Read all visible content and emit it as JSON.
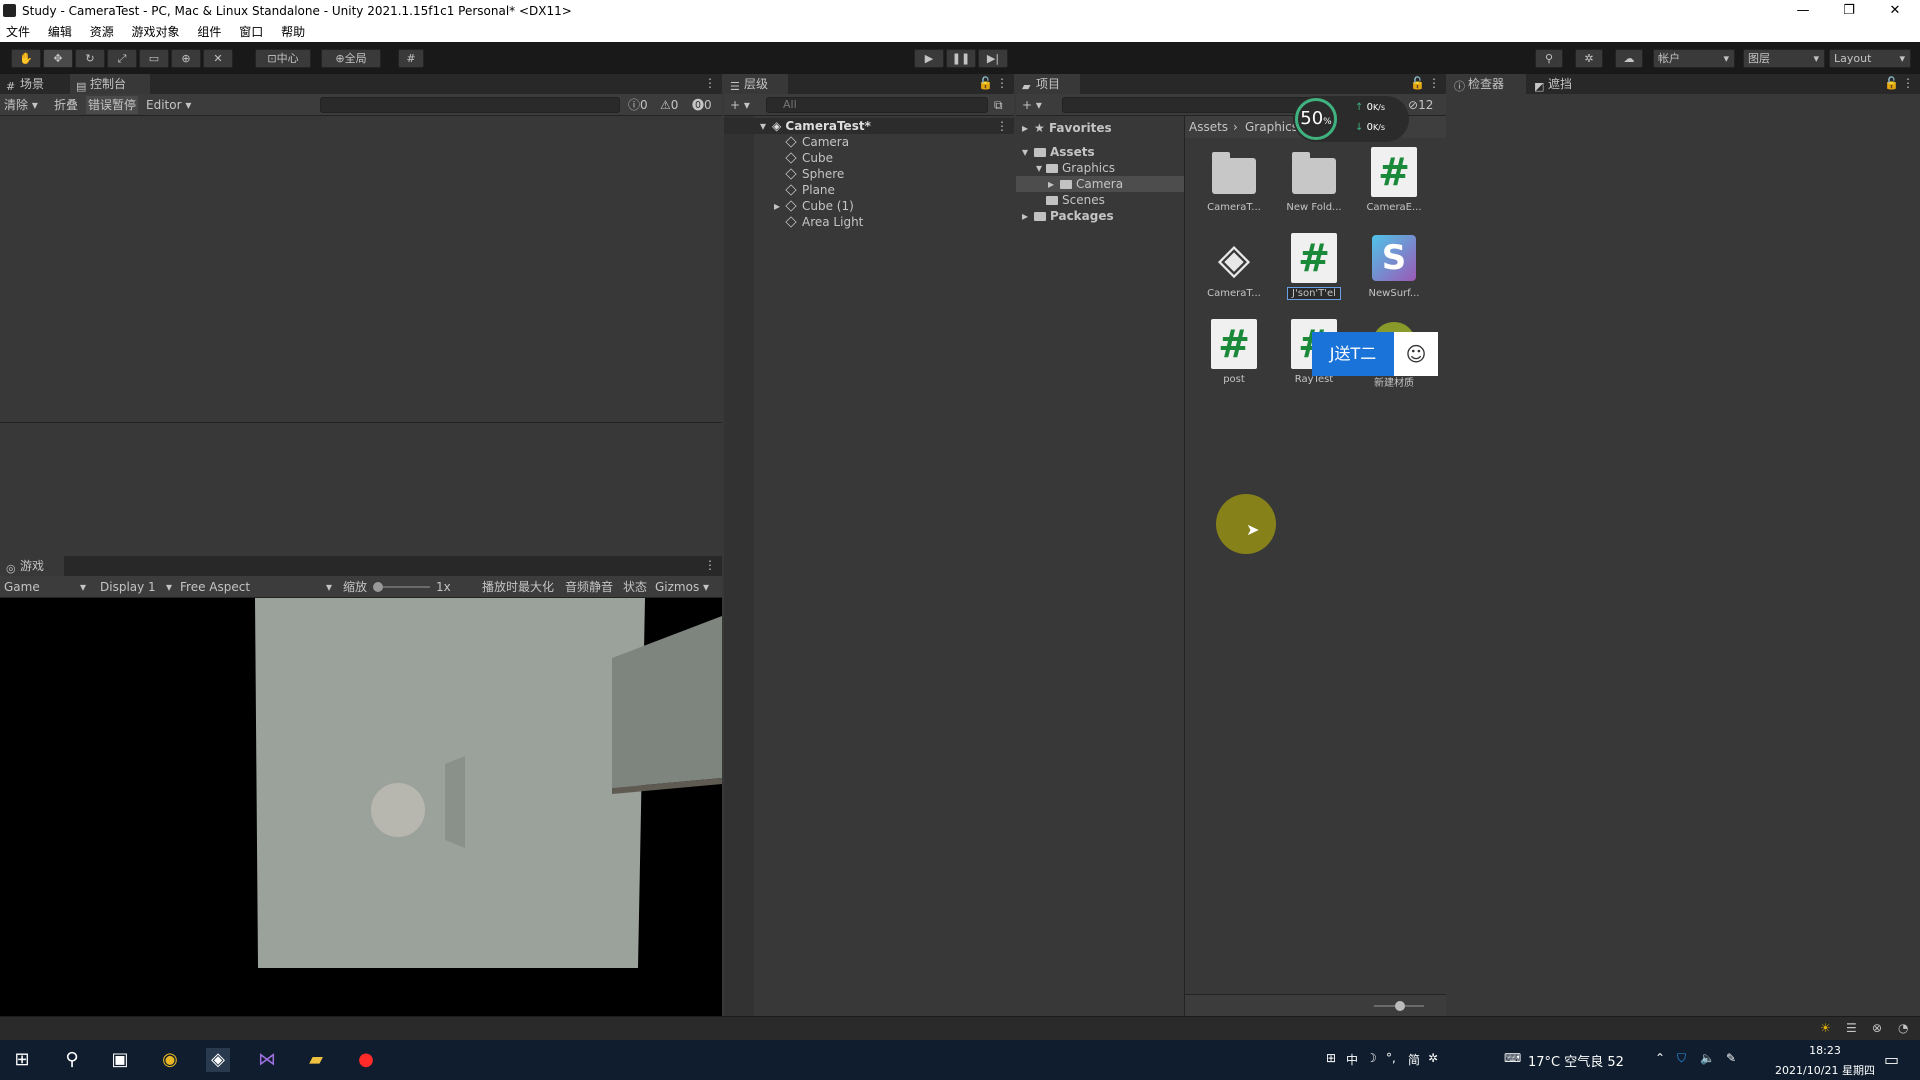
{
  "window": {
    "title": "Study - CameraTest - PC, Mac & Linux Standalone - Unity 2021.1.15f1c1 Personal* <DX11>",
    "controls": [
      "—",
      "❐",
      "✕"
    ]
  },
  "menu": [
    "文件",
    "编辑",
    "资源",
    "游戏对象",
    "组件",
    "窗口",
    "帮助"
  ],
  "toolbar": {
    "pivot_label": "中心",
    "global_label": "全局",
    "account_label": "帐户",
    "layers_label": "图层",
    "layout_label": "Layout"
  },
  "scene_panel": {
    "tabs": [
      "场景",
      "控制台"
    ],
    "console_bar": {
      "clear": "清除",
      "collapse": "折叠",
      "error_pause": "错误暂停",
      "editor": "Editor",
      "count_log": "0",
      "count_warn": "0",
      "count_error": "0"
    }
  },
  "game_panel": {
    "tab": "游戏",
    "game_select": "Game",
    "display": "Display 1",
    "aspect": "Free Aspect",
    "scale_label": "缩放",
    "scale_value": "1x",
    "maximize": "播放时最大化",
    "mute": "音频静音",
    "stats": "状态",
    "gizmos": "Gizmos"
  },
  "hierarchy": {
    "tab": "层级",
    "search_placeholder": "All",
    "root": "CameraTest*",
    "items": [
      "Camera",
      "Cube",
      "Sphere",
      "Plane",
      "Cube (1)",
      "Area Light"
    ]
  },
  "project": {
    "tab": "项目",
    "hidden_count": "12",
    "favorites": "Favorites",
    "assets": "Assets",
    "graphics": "Graphics",
    "camera": "Camera",
    "scenes": "Scenes",
    "packages": "Packages",
    "breadcrumb": [
      "Assets",
      "Graphics"
    ],
    "grid": [
      "CameraT...",
      "New Fold...",
      "CameraE...",
      "CameraT...",
      "J'son'T'el",
      "NewSurf...",
      "post",
      "RayTest",
      "新建材质"
    ]
  },
  "inspector": {
    "tabs": [
      "检查器",
      "遮挡"
    ]
  },
  "overlays": {
    "net_percent": "50",
    "net_up": "0",
    "net_down": "0",
    "ime_text": "J送T二"
  },
  "taskbar": {
    "ime": [
      "中",
      "简"
    ],
    "weather": "17°C 空气良 52",
    "time": "18:23",
    "date": "2021/10/21 星期四"
  }
}
